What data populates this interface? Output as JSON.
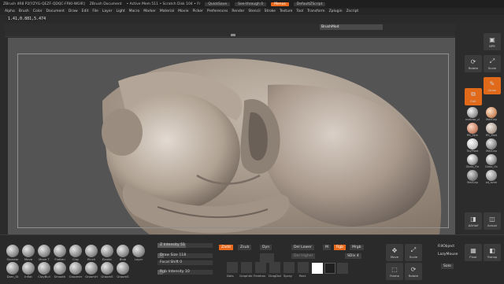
{
  "titlebar": {
    "app": "ZBrush 4R8 P2[YZYG-QEZF-QDQC-FRKI-WGIR]",
    "document": "ZBrush Document",
    "status": "• Active Mem 511 • Scratch Disk 104 • Fr",
    "quicksave": "QuickSave",
    "seethrough": "See-through 0",
    "menus": "Menus",
    "script": "DefaultZScript"
  },
  "menubar": [
    "Alpha",
    "Brush",
    "Color",
    "Document",
    "Draw",
    "Edit",
    "File",
    "Layer",
    "Light",
    "Macro",
    "Marker",
    "Material",
    "Movie",
    "Picker",
    "Preferences",
    "Render",
    "Stencil",
    "Stroke",
    "Texture",
    "Tool",
    "Transform",
    "Zplugin",
    "Zscript"
  ],
  "info": {
    "coords": "1.41,0.881,5.474"
  },
  "topshelf": {
    "brushmod": "BrushMod"
  },
  "rightshelf": {
    "buttons": [
      {
        "id": "bpr",
        "label": "BPR"
      },
      {
        "id": "scale",
        "label": "Scale"
      },
      {
        "id": "rotate",
        "label": "Rotate"
      },
      {
        "id": "draw",
        "label": "Draw"
      },
      {
        "id": "edit",
        "label": "Edit"
      }
    ],
    "materials": [
      "matcap_cl",
      "MatCap",
      "RS_Skin",
      "RS_Mod",
      "ToyPlast",
      "MatCap",
      "Gloss_Fle",
      "Gloss_Oc",
      "MatCap",
      "sd_azim"
    ],
    "lower": [
      {
        "id": "aahalf",
        "label": "AAHalf"
      },
      {
        "id": "actual",
        "label": "Actual"
      },
      {
        "id": "persp",
        "label": "Persp"
      },
      {
        "id": "floor",
        "label": "Floor"
      }
    ]
  },
  "bottom": {
    "brushes_row1": [
      "Standar",
      "Move",
      "Move T",
      "Flatten",
      "Clay",
      "Pinch",
      "Elastic",
      "Blob",
      "Layer"
    ],
    "brushes_row2": [
      "Dam_St",
      "Inflat",
      "ClayBuil",
      "Smooth",
      "Groomer",
      "GroomH",
      "GroomS",
      "GroomS"
    ],
    "z_intensity": {
      "label": "Z Intensity",
      "value": 51,
      "max": 100
    },
    "draw_size": {
      "label": "Draw Size",
      "value": 118,
      "max": 1000
    },
    "focal_shift": {
      "label": "Focal Shift",
      "value": 0,
      "max": 100
    },
    "rgb_intensity": {
      "label": "Rgb Intensity",
      "value": 10,
      "max": 100
    },
    "zadd": "Zadd",
    "zsub": "Zsub",
    "dyn": "Dyn",
    "mrgb": "Mrgb",
    "rgb": "Rgb",
    "m": "M",
    "del_lower": "Del Lower",
    "del_higher": "Del Higher",
    "sdiv": "SDiv 4",
    "strokes": [
      "Dots",
      "Graphite",
      "Freehan",
      "DragDot",
      "Spray",
      "Rect"
    ],
    "lazy": [
      "FillObject",
      "LazyMouse"
    ],
    "nav": [
      "Move",
      "Scale",
      "Rotate",
      "Frame",
      "Floor",
      "Transp"
    ],
    "bottom_right": "Solo"
  },
  "colors": {
    "accent": "#e6691c",
    "viewport": "#545454",
    "clay": "#b5a89c"
  }
}
